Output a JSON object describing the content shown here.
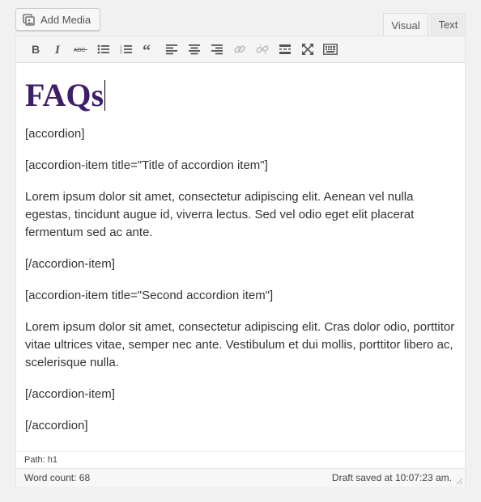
{
  "add_media": {
    "label": "Add Media",
    "icon": "add-media-icon"
  },
  "tabs": {
    "visual": "Visual",
    "text": "Text"
  },
  "toolbar": {
    "buttons": [
      "bold",
      "italic",
      "strikethrough",
      "bulleted-list",
      "numbered-list",
      "blockquote",
      "align-left",
      "align-center",
      "align-right",
      "insert-link",
      "remove-link",
      "read-more",
      "fullscreen",
      "toolbar-toggle"
    ]
  },
  "content": {
    "heading": "FAQs",
    "paragraphs": [
      "[accordion]",
      "[accordion-item title=\"Title of accordion item\"]",
      "Lorem ipsum dolor sit amet, consectetur adipiscing elit. Aenean vel nulla egestas, tincidunt augue id, viverra lectus. Sed vel odio eget elit placerat fermentum sed ac ante.",
      "[/accordion-item]",
      "[accordion-item title=\"Second accordion item\"]",
      "Lorem ipsum dolor sit amet, consectetur adipiscing elit. Cras dolor odio, porttitor vitae ultrices vitae, semper nec ante. Vestibulum et dui mollis, porttitor libero ac, scelerisque nulla.",
      "[/accordion-item]",
      "[/accordion]"
    ]
  },
  "path": "Path: h1",
  "status": {
    "word_count": "Word count: 68",
    "draft_saved": "Draft saved at 10:07:23 am."
  },
  "colors": {
    "heading": "#3e1f67",
    "text": "#333333",
    "toolbar_bg": "#f5f5f5"
  }
}
